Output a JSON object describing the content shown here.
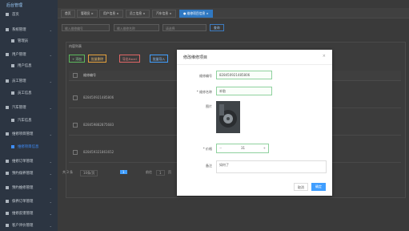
{
  "app": {
    "title": "后台管理"
  },
  "sidebar": {
    "items": [
      {
        "label": "首页",
        "sub": false,
        "chevron": false
      },
      {
        "label": "系统管理",
        "sub": false,
        "chevron": true
      },
      {
        "label": "管理员",
        "sub": true,
        "chevron": false
      },
      {
        "label": "用户管理",
        "sub": false,
        "chevron": true
      },
      {
        "label": "用户信息",
        "sub": true,
        "chevron": false
      },
      {
        "label": "员工管理",
        "sub": false,
        "chevron": true
      },
      {
        "label": "员工信息",
        "sub": true,
        "chevron": false
      },
      {
        "label": "汽车管理",
        "sub": false,
        "chevron": true
      },
      {
        "label": "汽车信息",
        "sub": true,
        "chevron": false
      },
      {
        "label": "维修项目管理",
        "sub": false,
        "chevron": true
      },
      {
        "label": "维修项目信息",
        "sub": true,
        "chevron": false,
        "active": true
      },
      {
        "label": "维修订单管理",
        "sub": false,
        "chevron": true
      },
      {
        "label": "预约保养管理",
        "sub": false,
        "chevron": true
      },
      {
        "label": "预约维修管理",
        "sub": false,
        "chevron": true
      },
      {
        "label": "保养订单管理",
        "sub": false,
        "chevron": true
      },
      {
        "label": "维修反馈管理",
        "sub": false,
        "chevron": true
      },
      {
        "label": "客户评价管理",
        "sub": false,
        "chevron": true
      }
    ]
  },
  "tabs": [
    {
      "label": "首页"
    },
    {
      "label": "管理员 ×"
    },
    {
      "label": "用户信息 ×"
    },
    {
      "label": "员工信息 ×"
    },
    {
      "label": "汽车信息 ×"
    },
    {
      "label": "● 维修项目信息 ×",
      "active": true
    }
  ],
  "filters": {
    "f1_placeholder": "输入维修编号",
    "f2_placeholder": "输入维修名称",
    "f3_placeholder": "请选择",
    "query_label": "查询"
  },
  "table": {
    "card_title": "内容列表",
    "actions": {
      "add": "+ 添加",
      "batch_delete": "批量删除",
      "export": "导出Excel",
      "import": "批量导入"
    },
    "header_col": "维修编号",
    "rows": [
      {
        "code": "828450921485806"
      },
      {
        "code": "828459882875683"
      },
      {
        "code": "828459321861652"
      }
    ]
  },
  "pagination": {
    "total": "共 3 条",
    "page_size": "10条/页",
    "current": "1",
    "goto_label": "前往",
    "goto_value": "1",
    "page_unit": "页"
  },
  "modal": {
    "title": "修改维修项目",
    "close": "×",
    "fields": {
      "code_label": "维修编号",
      "code_value": "828450921485806",
      "name_label": "* 维修名称",
      "name_value": "补胎",
      "image_label": "图片",
      "price_label": "* 价格",
      "price_minus": "−",
      "price_value": "31",
      "price_plus": "+",
      "remark_label": "备注",
      "remark_value": "如何了"
    },
    "cancel_label": "取消",
    "ok_label": "确定"
  },
  "colors": {
    "primary": "#409eff",
    "sidebar_bg": "#2c3542",
    "success_border": "#8fd19e"
  }
}
